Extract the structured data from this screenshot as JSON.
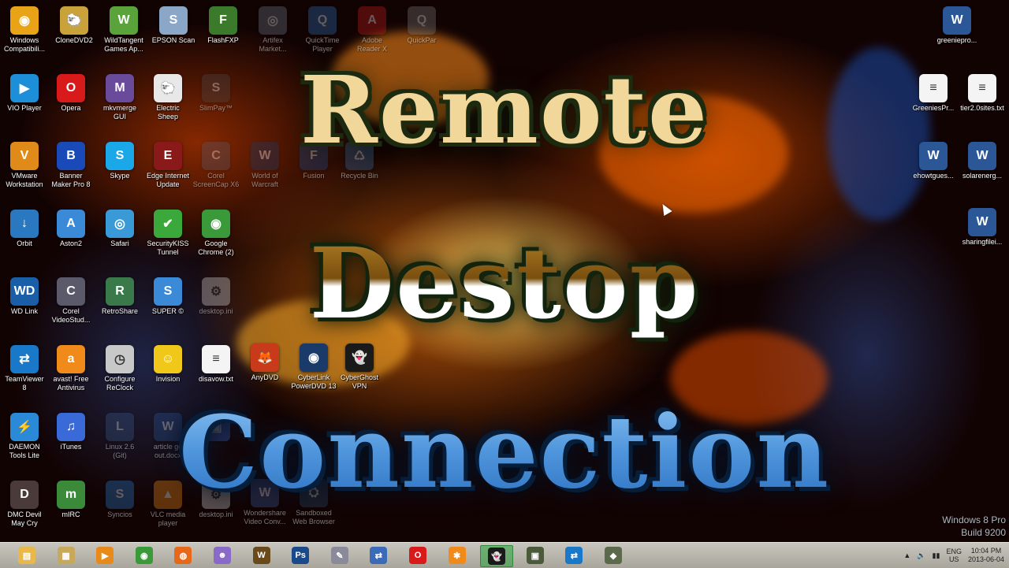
{
  "desktop_icons_left": [
    {
      "label": "Windows\nCompatibili...",
      "color": "#e8a317",
      "glyph": "◉"
    },
    {
      "label": "CloneDVD2",
      "color": "#c9a23a",
      "glyph": "🐑"
    },
    {
      "label": "WildTangent\nGames Ap...",
      "color": "#5aa23a",
      "glyph": "W"
    },
    {
      "label": "EPSON Scan",
      "color": "#8aa7c8",
      "glyph": "S"
    },
    {
      "label": "FlashFXP",
      "color": "#3a7a2a",
      "glyph": "F"
    },
    {
      "label": "Artifex\nMarket...",
      "color": "#6a7a8a",
      "glyph": "◎"
    },
    {
      "label": "QuickTime\nPlayer",
      "color": "#2a6fb4",
      "glyph": "Q"
    },
    {
      "label": "Adobe\nReader X",
      "color": "#c41a1a",
      "glyph": "A"
    },
    {
      "label": "QuickPar",
      "color": "#7a7a7a",
      "glyph": "Q"
    }
  ],
  "desktop_icons_col1": [
    {
      "label": "VIO Player",
      "color": "#1c8fd8",
      "glyph": "▶"
    },
    {
      "label": "VMware\nWorkstation",
      "color": "#e08a1a",
      "glyph": "V"
    },
    {
      "label": "Orbit",
      "color": "#2a78c0",
      "glyph": "↓"
    },
    {
      "label": "WD Link",
      "color": "#1a5ea8",
      "glyph": "WD"
    },
    {
      "label": "TeamViewer\n8",
      "color": "#1a78c8",
      "glyph": "⇄"
    },
    {
      "label": "DAEMON\nTools Lite",
      "color": "#2a8ad8",
      "glyph": "⚡"
    },
    {
      "label": "DMC Devil\nMay Cry",
      "color": "#4a3a3a",
      "glyph": "D"
    }
  ],
  "desktop_icons_col2": [
    {
      "label": "Opera",
      "color": "#d81a1a",
      "glyph": "O"
    },
    {
      "label": "Banner\nMaker Pro 8",
      "color": "#1a4ab8",
      "glyph": "B"
    },
    {
      "label": "Aston2",
      "color": "#3a8ad8",
      "glyph": "A"
    },
    {
      "label": "Corel\nVideoStud...",
      "color": "#5a5a6a",
      "glyph": "C"
    },
    {
      "label": "avast! Free\nAntivirus",
      "color": "#f08a1a",
      "glyph": "a"
    },
    {
      "label": "iTunes",
      "color": "#3a6ad8",
      "glyph": "♫"
    },
    {
      "label": "mIRC",
      "color": "#3a8a3a",
      "glyph": "m"
    }
  ],
  "desktop_icons_col3": [
    {
      "label": "mkvmerge\nGUI",
      "color": "#6a4a9a",
      "glyph": "M"
    },
    {
      "label": "Skype",
      "color": "#1aa8e8",
      "glyph": "S"
    },
    {
      "label": "Safari",
      "color": "#3a9ad8",
      "glyph": "◎"
    },
    {
      "label": "RetroShare",
      "color": "#3a7a4a",
      "glyph": "R"
    },
    {
      "label": "Configure\nReClock",
      "color": "#c8c8c8",
      "glyph": "◷"
    },
    {
      "label": "Linux 2.6\n(Git)",
      "color": "#3a5a8a",
      "glyph": "L"
    },
    {
      "label": "Syncios",
      "color": "#2a7ac8",
      "glyph": "S"
    }
  ],
  "desktop_icons_col4": [
    {
      "label": "Electric\nSheep",
      "color": "#e8e8e8",
      "glyph": "🐑"
    },
    {
      "label": "Edge Internet\nUpdate",
      "color": "#8a1a1a",
      "glyph": "E"
    },
    {
      "label": "SecurityKISS\nTunnel",
      "color": "#3aa83a",
      "glyph": "✔"
    },
    {
      "label": "SUPER ©",
      "color": "#3a8ad8",
      "glyph": "S"
    },
    {
      "label": "Invision",
      "color": "#f0c81a",
      "glyph": "☺"
    },
    {
      "label": "article go\nout.docx",
      "color": "#2b5797",
      "glyph": "W"
    },
    {
      "label": "VLC media\nplayer",
      "color": "#f08a1a",
      "glyph": "▲"
    }
  ],
  "desktop_icons_col5": [
    {
      "label": "SlimPay™",
      "color": "#4a4a4a",
      "glyph": "S"
    },
    {
      "label": "Corel\nScreenCap X6",
      "color": "#5a5a6a",
      "glyph": "C"
    },
    {
      "label": "Google\nChrome (2)",
      "color": "#3a9a3a",
      "glyph": "◉"
    },
    {
      "label": "desktop.ini",
      "color": "#d8d8d8",
      "glyph": "⚙"
    },
    {
      "label": "disavow.txt",
      "color": "#f4f4f4",
      "glyph": "≡"
    },
    {
      "label": "",
      "color": "#3a6ad8",
      "glyph": "▣"
    },
    {
      "label": "desktop.ini",
      "color": "#d8d8d8",
      "glyph": "⚙"
    }
  ],
  "desktop_icons_col6": [
    {
      "label": "World of\nWarcraft",
      "color": "#1a3a6a",
      "glyph": "W"
    },
    {
      "label": "AnyDVD",
      "color": "#c83a1a",
      "glyph": "🦊"
    },
    {
      "label": "Wondershare\nVideo Conv...",
      "color": "#3a5a9a",
      "glyph": "W"
    }
  ],
  "desktop_icons_col7": [
    {
      "label": "Fusion",
      "color": "#1a4a8a",
      "glyph": "F"
    },
    {
      "label": "CyberLink\nPowerDVD 13",
      "color": "#1a3a6a",
      "glyph": "◉"
    },
    {
      "label": "Sandboxed\nWeb Browser",
      "color": "#2a4a6a",
      "glyph": "⛭"
    }
  ],
  "desktop_icons_col8": [
    {
      "label": "Recycle Bin",
      "color": "#3a6a9a",
      "glyph": "♺"
    },
    {
      "label": "CyberGhost\nVPN",
      "color": "#1a1a1a",
      "glyph": "👻"
    }
  ],
  "desktop_icons_right": [
    {
      "label": "greeniepro...",
      "color": "#2b5797",
      "glyph": "W"
    },
    {
      "label": "GreeniesPr...",
      "color": "#f4f4f4",
      "glyph": "≡"
    },
    {
      "label": "tier2.0sites.txt",
      "color": "#f4f4f4",
      "glyph": "≡"
    },
    {
      "label": "ehowtgues...",
      "color": "#2b5797",
      "glyph": "W"
    },
    {
      "label": "solarenerg...",
      "color": "#2b5797",
      "glyph": "W"
    },
    {
      "label": "sharingfilei...",
      "color": "#2b5797",
      "glyph": "W"
    }
  ],
  "overlay_title": {
    "line1": "Remote",
    "line2": "Destop",
    "line3": "Connection"
  },
  "watermark": {
    "line1": "Windows 8 Pro",
    "line2": "Build 9200"
  },
  "taskbar": {
    "pinned": [
      {
        "name": "file-explorer-icon",
        "color": "#e8b84a",
        "glyph": "▤",
        "active": false
      },
      {
        "name": "libraries-icon",
        "color": "#c8a85a",
        "glyph": "▦",
        "active": false
      },
      {
        "name": "media-player-icon",
        "color": "#e88a1a",
        "glyph": "▶",
        "active": false
      },
      {
        "name": "chrome-icon",
        "color": "#3a9a3a",
        "glyph": "◉",
        "active": false
      },
      {
        "name": "firefox-icon",
        "color": "#e8681a",
        "glyph": "◍",
        "active": false
      },
      {
        "name": "pidgin-icon",
        "color": "#8a6ac8",
        "glyph": "☻",
        "active": false
      },
      {
        "name": "warcraft-icon",
        "color": "#6a4a1a",
        "glyph": "W",
        "active": false
      },
      {
        "name": "photoshop-icon",
        "color": "#1a4a8a",
        "glyph": "Ps",
        "active": false
      },
      {
        "name": "tool-icon",
        "color": "#8a8a9a",
        "glyph": "✎",
        "active": false
      },
      {
        "name": "network-icon",
        "color": "#3a6ab8",
        "glyph": "⇄",
        "active": false
      },
      {
        "name": "opera-icon",
        "color": "#d81a1a",
        "glyph": "O",
        "active": false
      },
      {
        "name": "avast-icon",
        "color": "#f08a1a",
        "glyph": "✱",
        "active": false
      },
      {
        "name": "cyberghost-icon",
        "color": "#1a1a1a",
        "glyph": "👻",
        "active": true
      },
      {
        "name": "remote-desktop-icon",
        "color": "#4a5a3a",
        "glyph": "▣",
        "active": false
      },
      {
        "name": "teamviewer-icon",
        "color": "#1a78c8",
        "glyph": "⇄",
        "active": false
      },
      {
        "name": "app-icon",
        "color": "#5a6a4a",
        "glyph": "◆",
        "active": false
      }
    ],
    "tray": {
      "lang_line1": "ENG",
      "lang_line2": "US",
      "time": "10:04 PM",
      "date": "2013-06-04"
    }
  }
}
